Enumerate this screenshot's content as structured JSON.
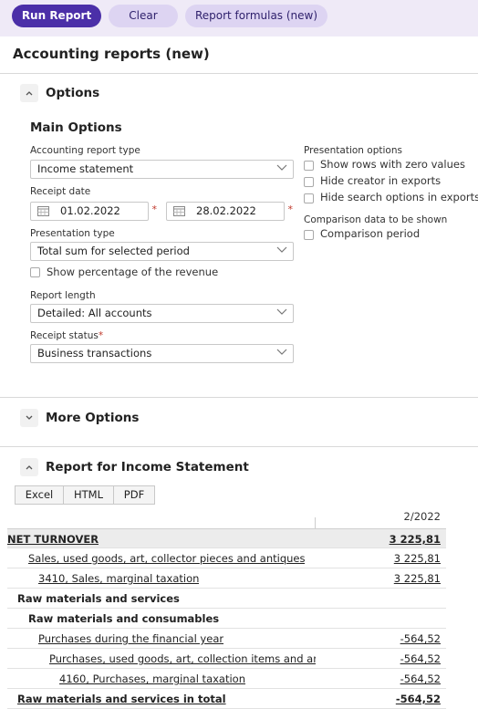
{
  "toolbar": {
    "run_report": "Run Report",
    "clear": "Clear",
    "report_formulas": "Report formulas (new)"
  },
  "page_title": "Accounting reports (new)",
  "options": {
    "title": "Options",
    "main_title": "Main Options",
    "report_type_label": "Accounting report type",
    "report_type_value": "Income statement",
    "receipt_date_label": "Receipt date",
    "date_from": "01.02.2022",
    "date_to": "28.02.2022",
    "presentation_type_label": "Presentation type",
    "presentation_type_value": "Total sum for selected period",
    "show_percentage": "Show percentage of the revenue",
    "report_length_label": "Report length",
    "report_length_value": "Detailed: All accounts",
    "receipt_status_label": "Receipt status",
    "receipt_status_value": "Business transactions",
    "presentation_options_label": "Presentation options",
    "show_zero_rows": "Show rows with zero values",
    "hide_creator": "Hide creator in exports",
    "hide_search": "Hide search options in exports",
    "comparison_label": "Comparison data to be shown",
    "comparison_period": "Comparison period"
  },
  "more_options": {
    "title": "More Options"
  },
  "report": {
    "title": "Report for Income Statement",
    "exports": [
      "Excel",
      "HTML",
      "PDF"
    ],
    "column_header": "2/2022",
    "rows": [
      {
        "name": "NET TURNOVER",
        "amount": "3 225,81"
      },
      {
        "name": "Sales, used goods, art, collector pieces and antiques",
        "amount": "3 225,81"
      },
      {
        "name": "3410, Sales, marginal taxation",
        "amount": "3 225,81"
      },
      {
        "name": "Raw materials and services",
        "amount": ""
      },
      {
        "name": "Raw materials and consumables",
        "amount": ""
      },
      {
        "name": "Purchases during the financial year",
        "amount": "-564,52"
      },
      {
        "name": "Purchases, used goods, art, collection items and antiques",
        "amount": "-564,52"
      },
      {
        "name": "4160, Purchases, marginal taxation",
        "amount": "-564,52"
      },
      {
        "name": "Raw materials and services in total",
        "amount": "-564,52"
      }
    ]
  }
}
